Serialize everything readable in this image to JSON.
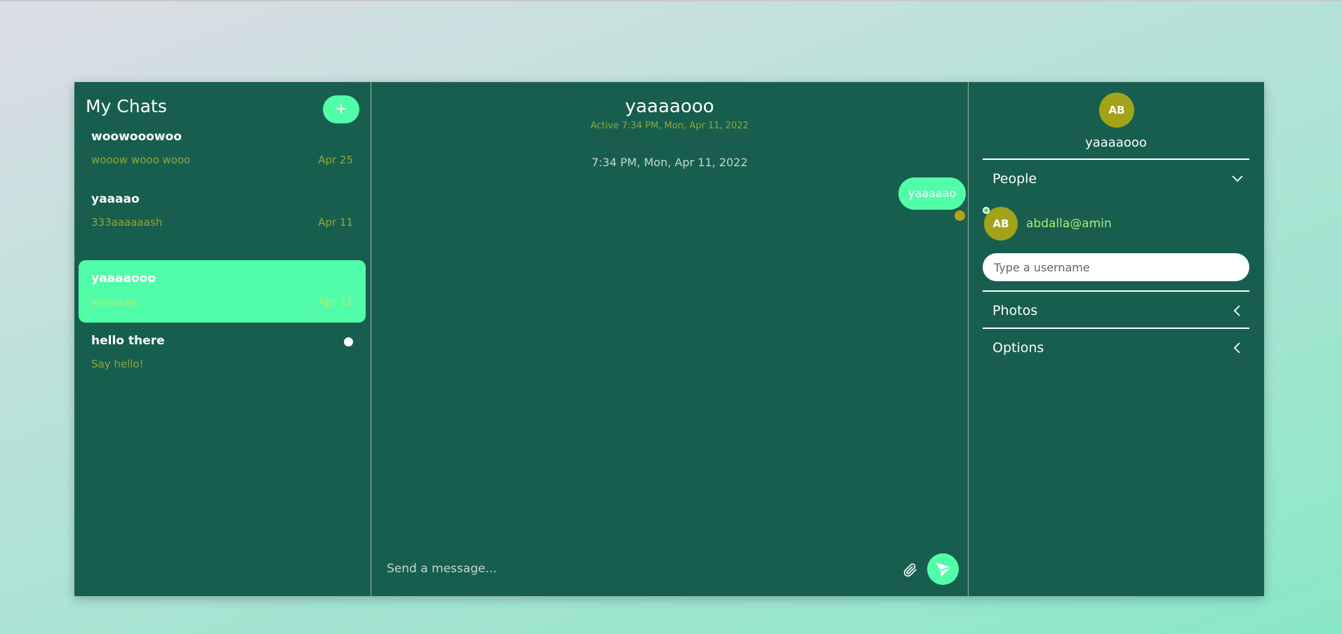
{
  "sidebar": {
    "title": "My Chats",
    "add_label": "+",
    "chats": [
      {
        "name": "woowooowoo",
        "preview": "wooow wooo wooo",
        "date": "Apr 25"
      },
      {
        "name": "yaaaao",
        "preview": "333aaaaaash",
        "date": "Apr 11"
      },
      {
        "name": "yaaaaooo",
        "preview": "yaaaaao",
        "date": "Apr 11"
      },
      {
        "name": "hello there",
        "preview": "Say hello!",
        "date": ""
      }
    ]
  },
  "chat": {
    "title": "yaaaaooo",
    "active": "Active 7:34 PM, Mon, Apr 11, 2022",
    "messages": [
      {
        "time": "7:34 PM, Mon, Apr 11, 2022",
        "text": "yaaaaao"
      }
    ],
    "input_placeholder": "Send a message..."
  },
  "details": {
    "avatar_initials": "AB",
    "name": "yaaaaooo",
    "people_label": "People",
    "people": [
      {
        "initials": "AB",
        "username": "abdalla@amin"
      }
    ],
    "username_placeholder": "Type a username",
    "photos_label": "Photos",
    "options_label": "Options"
  },
  "icons": {
    "add": "plus-icon",
    "attach": "paperclip-icon",
    "send": "send-icon",
    "people_toggle": "chevron-down-icon",
    "photos_toggle": "chevron-left-icon",
    "options_toggle": "chevron-left-icon"
  },
  "colors": {
    "panel": "#175e4f",
    "accent": "#52fda9",
    "avatar": "#a2a319",
    "muted_text": "#8ea83a",
    "highlight_text": "#a8f070"
  }
}
